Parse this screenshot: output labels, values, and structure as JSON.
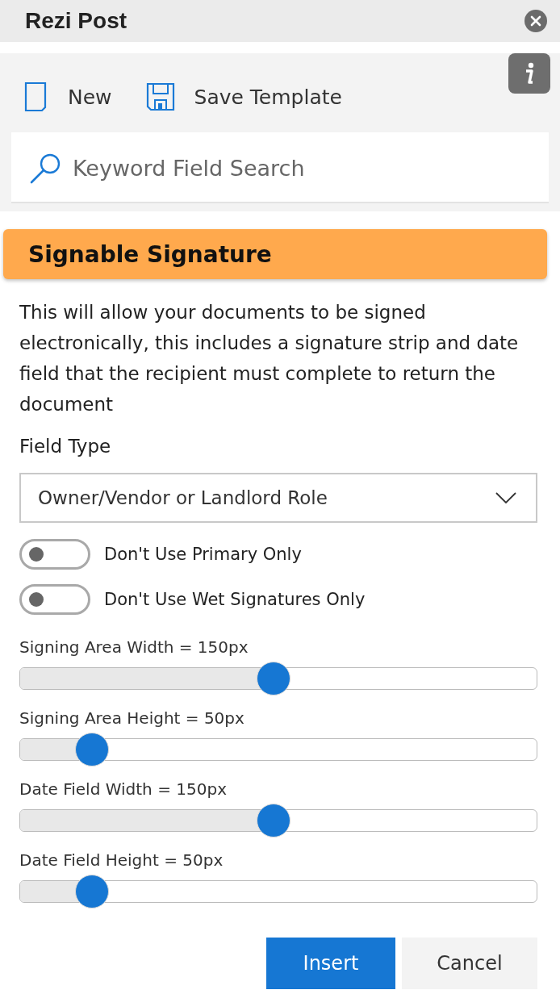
{
  "window": {
    "title": "Rezi Post"
  },
  "toolbar": [
    {
      "kind": "new",
      "label": "New"
    },
    {
      "kind": "save",
      "label": "Save Template"
    }
  ],
  "search": {
    "placeholder": "Keyword Field Search"
  },
  "section": {
    "title": "Signable Signature",
    "description": "This will allow your documents to be signed electronically, this includes a signature strip and date field that the recipient must complete to return the document"
  },
  "field_type": {
    "label": "Field Type",
    "value": "Owner/Vendor or Landlord Role"
  },
  "toggles": [
    {
      "label": "Don't Use Primary Only",
      "on": false
    },
    {
      "label": "Don't Use Wet Signatures Only",
      "on": false
    }
  ],
  "sliders": [
    {
      "label": "Signing Area Width = 150px",
      "level": 0.49
    },
    {
      "label": "Signing Area Height = 50px",
      "level": 0.14
    },
    {
      "label": "Date Field Width = 150px",
      "level": 0.49
    },
    {
      "label": "Date Field Height = 50px",
      "level": 0.14
    }
  ],
  "buttons": [
    {
      "kind": "primary",
      "label": "Insert"
    },
    {
      "kind": "secondary",
      "label": "Cancel"
    }
  ]
}
